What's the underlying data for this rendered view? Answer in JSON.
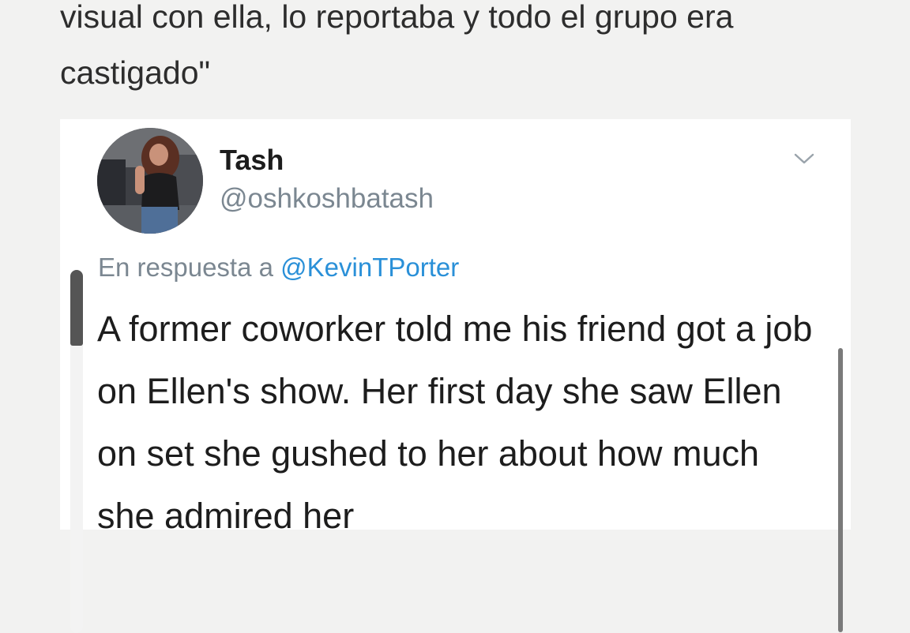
{
  "article": {
    "text": "visual con ella, lo reportaba y todo el grupo era castigado\""
  },
  "tweet": {
    "display_name": "Tash",
    "handle": "@oshkoshbatash",
    "reply_prefix": "En respuesta a",
    "reply_mention": "@KevinTPorter",
    "body": "A former coworker told me his friend got a job on Ellen's show. Her first day she saw Ellen on set she gushed to her about how much she admired her"
  },
  "icons": {
    "menu": "chevron-down-icon",
    "avatar": "profile-photo"
  },
  "colors": {
    "background": "#f2f2f1",
    "card": "#ffffff",
    "text": "#1d1d1d",
    "muted": "#7b8791",
    "link": "#2a90d8"
  }
}
